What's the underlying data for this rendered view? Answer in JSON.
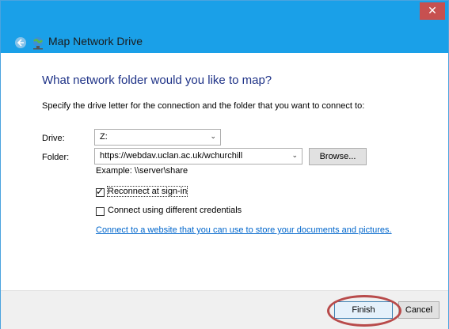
{
  "window": {
    "title": "Map Network Drive",
    "close_glyph": "✕"
  },
  "content": {
    "heading": "What network folder would you like to map?",
    "instruction": "Specify the drive letter for the connection and the folder that you want to connect to:"
  },
  "drive": {
    "label": "Drive:",
    "value": "Z:"
  },
  "folder": {
    "label": "Folder:",
    "value": "https://webdav.uclan.ac.uk/wchurchill",
    "browse_label": "Browse..."
  },
  "example": "Example: \\\\server\\share",
  "options": {
    "reconnect_label": "Reconnect at sign-in",
    "reconnect_checked": true,
    "credentials_label": "Connect using different credentials",
    "credentials_checked": false
  },
  "link_text": "Connect to a website that you can use to store your documents and pictures.",
  "footer": {
    "finish_label": "Finish",
    "cancel_label": "Cancel"
  },
  "colors": {
    "titlebar": "#1aa0e8",
    "heading": "#1e3287",
    "link": "#0066cc",
    "annotation_circle": "#b84b4b"
  },
  "icons": {
    "back": "back-arrow-icon",
    "title": "network-drive-icon",
    "close": "close-icon",
    "dropdown": "chevron-down-icon",
    "check": "checkmark-icon"
  }
}
